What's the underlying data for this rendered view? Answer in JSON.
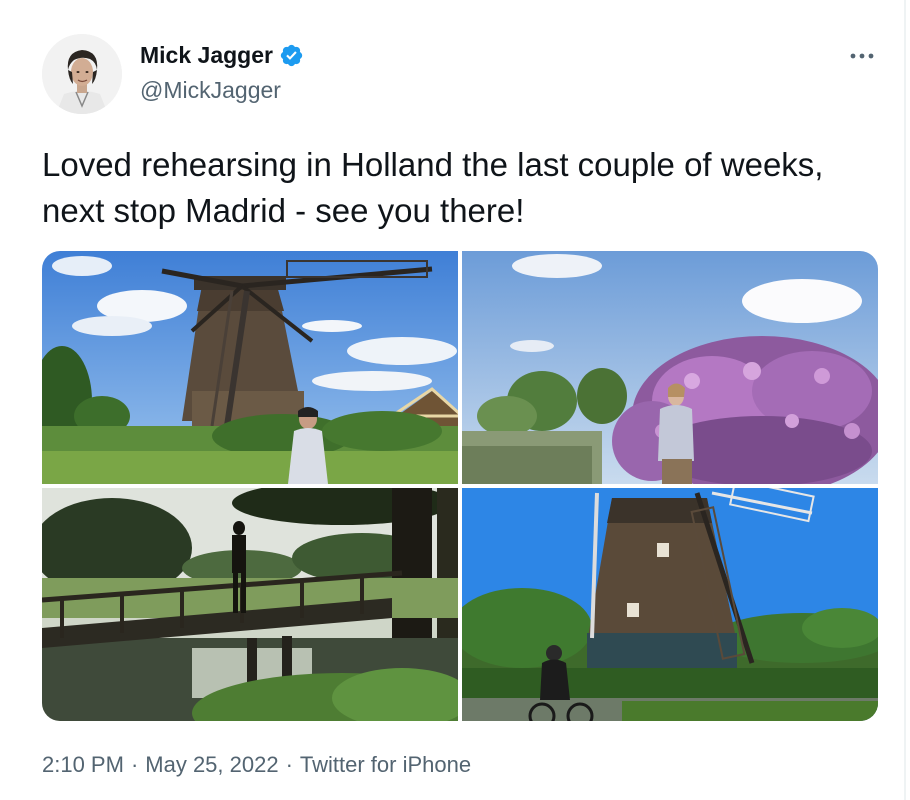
{
  "author": {
    "display_name": "Mick Jagger",
    "handle": "@MickJagger",
    "verified": true
  },
  "tweet": {
    "text": "Loved rehearsing in Holland the last couple of weeks, next stop Madrid - see you there!"
  },
  "media": [
    {
      "name": "windmill-front-photo"
    },
    {
      "name": "flowers-canal-photo"
    },
    {
      "name": "bridge-silhouette-photo"
    },
    {
      "name": "windmill-bicycle-photo"
    }
  ],
  "meta": {
    "time": "2:10 PM",
    "sep1": "·",
    "date": "May 25, 2022",
    "sep2": "·",
    "source": "Twitter for iPhone"
  },
  "colors": {
    "verified": "#1d9bf0",
    "secondary_text": "#536471",
    "primary_text": "#0f1419"
  },
  "icons": [
    "verified-badge-icon",
    "more-options-icon"
  ]
}
